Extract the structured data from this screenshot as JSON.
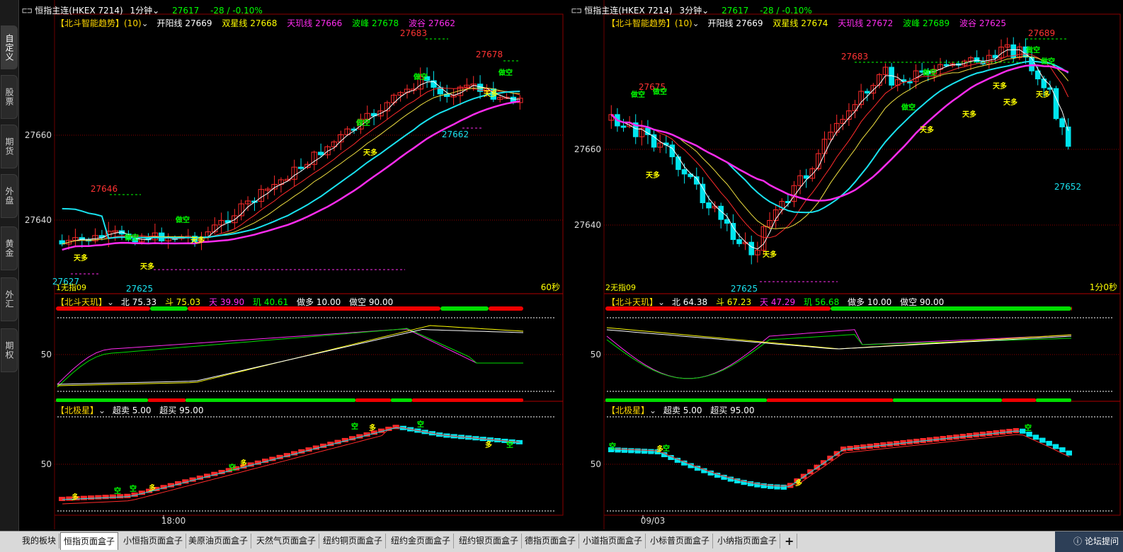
{
  "sidebar": {
    "tabs": [
      "自定义",
      "股票",
      "期货",
      "外盘",
      "黄金",
      "外汇",
      "期权"
    ]
  },
  "bottom_tabs": [
    "我的板块",
    "恒指页面盒子",
    "小恒指页面盒子",
    "美原油页面盒子",
    "天然气页面盒子",
    "纽约铜页面盒子",
    "纽约金页面盒子",
    "纽约银页面盒子",
    "德指页面盒子",
    "小道指页面盒子",
    "小标普页面盒子",
    "小纳指页面盒子",
    "+"
  ],
  "active_bottom_tab": 1,
  "status_right": "论坛提问",
  "colors": {
    "up": "#ff2b2b",
    "down": "#00e5ee",
    "ma_cyan": "#19e3f0",
    "ma_magenta": "#ff2cf0",
    "ma_yellow": "#f0e040",
    "ma_red": "#ff2b2b",
    "ma_white": "#ffffff",
    "grid": "#8b0000",
    "label_green": "#00ff00",
    "label_yellow": "#ffff00"
  },
  "panels": [
    {
      "title": "恒指主连(HKEX 7214)",
      "period": "1分钟",
      "price": "27617",
      "change": "-28 / -0.10%",
      "indicator1": {
        "name": "【北斗智能趋势】(10)",
        "kyx_label": "开阳线",
        "kyx": "27669",
        "sxx_label": "双星线",
        "sxx": "27668",
        "tjx_label": "天玑线",
        "tjx": "27666",
        "bf_label": "波峰",
        "bf": "27678",
        "bg_label": "波谷",
        "bg": "27662"
      },
      "y_ticks": [
        "27660",
        "27640"
      ],
      "peak_labels": [
        "27683",
        "27678",
        "27646",
        "27662",
        "27627",
        "27625"
      ],
      "corner_left": "1无指09",
      "corner_right": "60秒",
      "indicator2": {
        "name": "【北斗天玑】",
        "b_label": "北",
        "b": "75.33",
        "d_label": "斗",
        "d": "75.03",
        "t_label": "天",
        "t": "39.90",
        "j_label": "玑",
        "j": "40.61",
        "zd_label": "做多",
        "zd": "10.00",
        "zk_label": "做空",
        "zk": "90.00",
        "tick": "50"
      },
      "indicator3": {
        "name": "【北极星】",
        "cm_label": "超卖",
        "cm": "5.00",
        "cb_label": "超买",
        "cb": "95.00",
        "tick": "50"
      },
      "x_label": "18:00",
      "signals": {
        "long": "多",
        "short": "空",
        "do_short": "做空",
        "tian_duo": "天多"
      }
    },
    {
      "title": "恒指主连(HKEX 7214)",
      "period": "3分钟",
      "price": "27617",
      "change": "-28 / -0.10%",
      "indicator1": {
        "name": "【北斗智能趋势】(10)",
        "kyx_label": "开阳线",
        "kyx": "27669",
        "sxx_label": "双星线",
        "sxx": "27674",
        "tjx_label": "天玑线",
        "tjx": "27672",
        "bf_label": "波峰",
        "bf": "27689",
        "bg_label": "波谷",
        "bg": "27625"
      },
      "y_ticks": [
        "27660",
        "27640"
      ],
      "peak_labels": [
        "27689",
        "27683",
        "27675",
        "27652",
        "27625"
      ],
      "corner_left": "2无指09",
      "corner_right": "1分0秒",
      "indicator2": {
        "name": "【北斗天玑】",
        "b_label": "北",
        "b": "64.38",
        "d_label": "斗",
        "d": "67.23",
        "t_label": "天",
        "t": "47.29",
        "j_label": "玑",
        "j": "56.68",
        "zd_label": "做多",
        "zd": "10.00",
        "zk_label": "做空",
        "zk": "90.00",
        "tick": "50"
      },
      "indicator3": {
        "name": "【北极星】",
        "cm_label": "超卖",
        "cm": "5.00",
        "cb_label": "超买",
        "cb": "95.00",
        "tick": "50"
      },
      "x_label": "09/03",
      "signals": {
        "long": "多",
        "short": "空",
        "do_short": "做空",
        "tian_duo": "天多"
      }
    }
  ]
}
